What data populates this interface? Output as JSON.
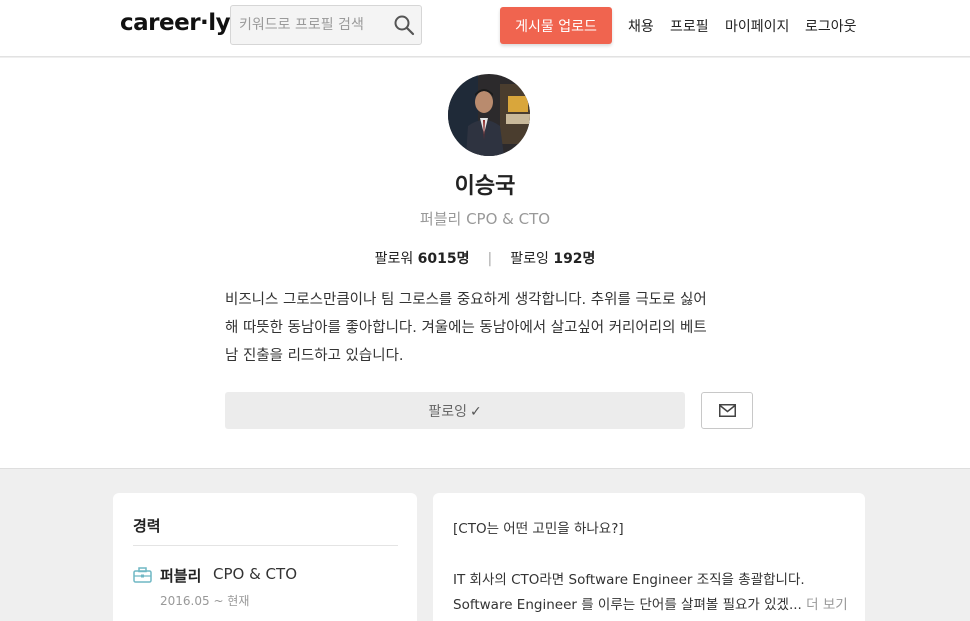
{
  "header": {
    "logo": "career·ly",
    "search_placeholder": "키워드로 프로필 검색",
    "upload_label": "게시물 업로드",
    "nav": [
      "채용",
      "프로필",
      "마이페이지",
      "로그아웃"
    ]
  },
  "profile": {
    "name": "이승국",
    "title": "퍼블리 CPO & CTO",
    "followers_label": "팔로워",
    "followers_count": "6015명",
    "following_label": "팔로잉",
    "following_count": "192명",
    "stats_separator": "|",
    "bio_lines": [
      "비즈니스 그로스만큼이나 팀 그로스를 중요하게 생각합니다. 추위를 극도로 싫어",
      "해 따뜻한 동남아를 좋아합니다. 겨울에는 동남아에서 살고싶어 커리어리의 베트",
      "남 진출을 리드하고 있습니다."
    ],
    "follow_label": "팔로잉",
    "follow_check": "✓"
  },
  "career": {
    "heading": "경력",
    "company": "퍼블리",
    "role": "CPO & CTO",
    "period": "2016.05 ~ 현재"
  },
  "post": {
    "line1": "[CTO는 어떤 고민을 하나요?]",
    "line2": "IT 회사의 CTO라면 Software Engineer 조직을 총괄합니다.",
    "line3": "Software Engineer 를 이루는 단어를 살펴볼 필요가 있겠...",
    "more_label": "더 보기"
  },
  "colors": {
    "accent": "#f0644f",
    "icon_teal": "#6fb7c4"
  }
}
